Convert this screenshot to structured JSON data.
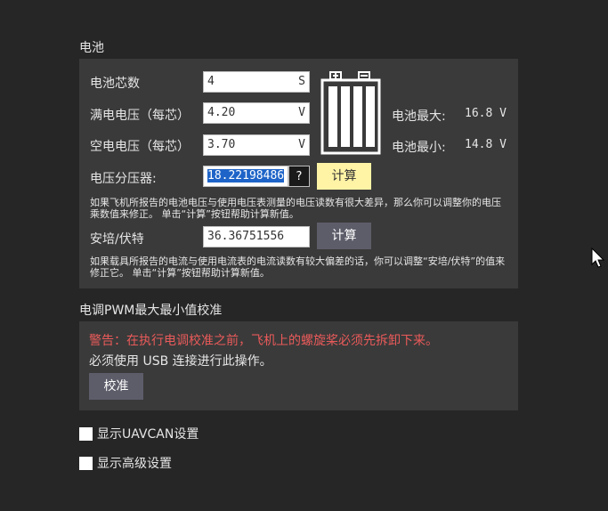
{
  "battery": {
    "title": "电池",
    "cells": {
      "label": "电池芯数",
      "value": "4",
      "unit": "S"
    },
    "full_voltage": {
      "label": "满电电压（每芯）",
      "value": "4.20",
      "unit": "V"
    },
    "empty_voltage": {
      "label": "空电电压（每芯）",
      "value": "3.70",
      "unit": "V"
    },
    "max": {
      "label": "电池最大:",
      "value": "16.8 V"
    },
    "min": {
      "label": "电池最小:",
      "value": "14.8 V"
    },
    "divider": {
      "label": "电压分压器:",
      "value": "18.22198486",
      "help": "?",
      "calc": "计算"
    },
    "divider_note": "如果飞机所报告的电池电压与使用电压表测量的电压读数有很大差异，那么你可以调整你的电压乘数值来修正。 单击“计算”按钮帮助计算新值。",
    "amps": {
      "label": "安培/伏特",
      "value": "36.36751556",
      "calc": "计算"
    },
    "amps_note": "如果载具所报告的电流与使用电流表的电流读数有较大偏差的话，你可以调整“安培/伏特”的值来修正它。 单击“计算”按钮帮助计算新值。"
  },
  "esc": {
    "title": "电调PWM最大最小值校准",
    "warning": "警告：在执行电调校准之前，飞机上的螺旋桨必须先拆卸下来。",
    "usb_note": "必须使用 USB 连接进行此操作。",
    "calibrate": "校准"
  },
  "options": {
    "uavcan": "显示UAVCAN设置",
    "advanced": "显示高级设置"
  }
}
